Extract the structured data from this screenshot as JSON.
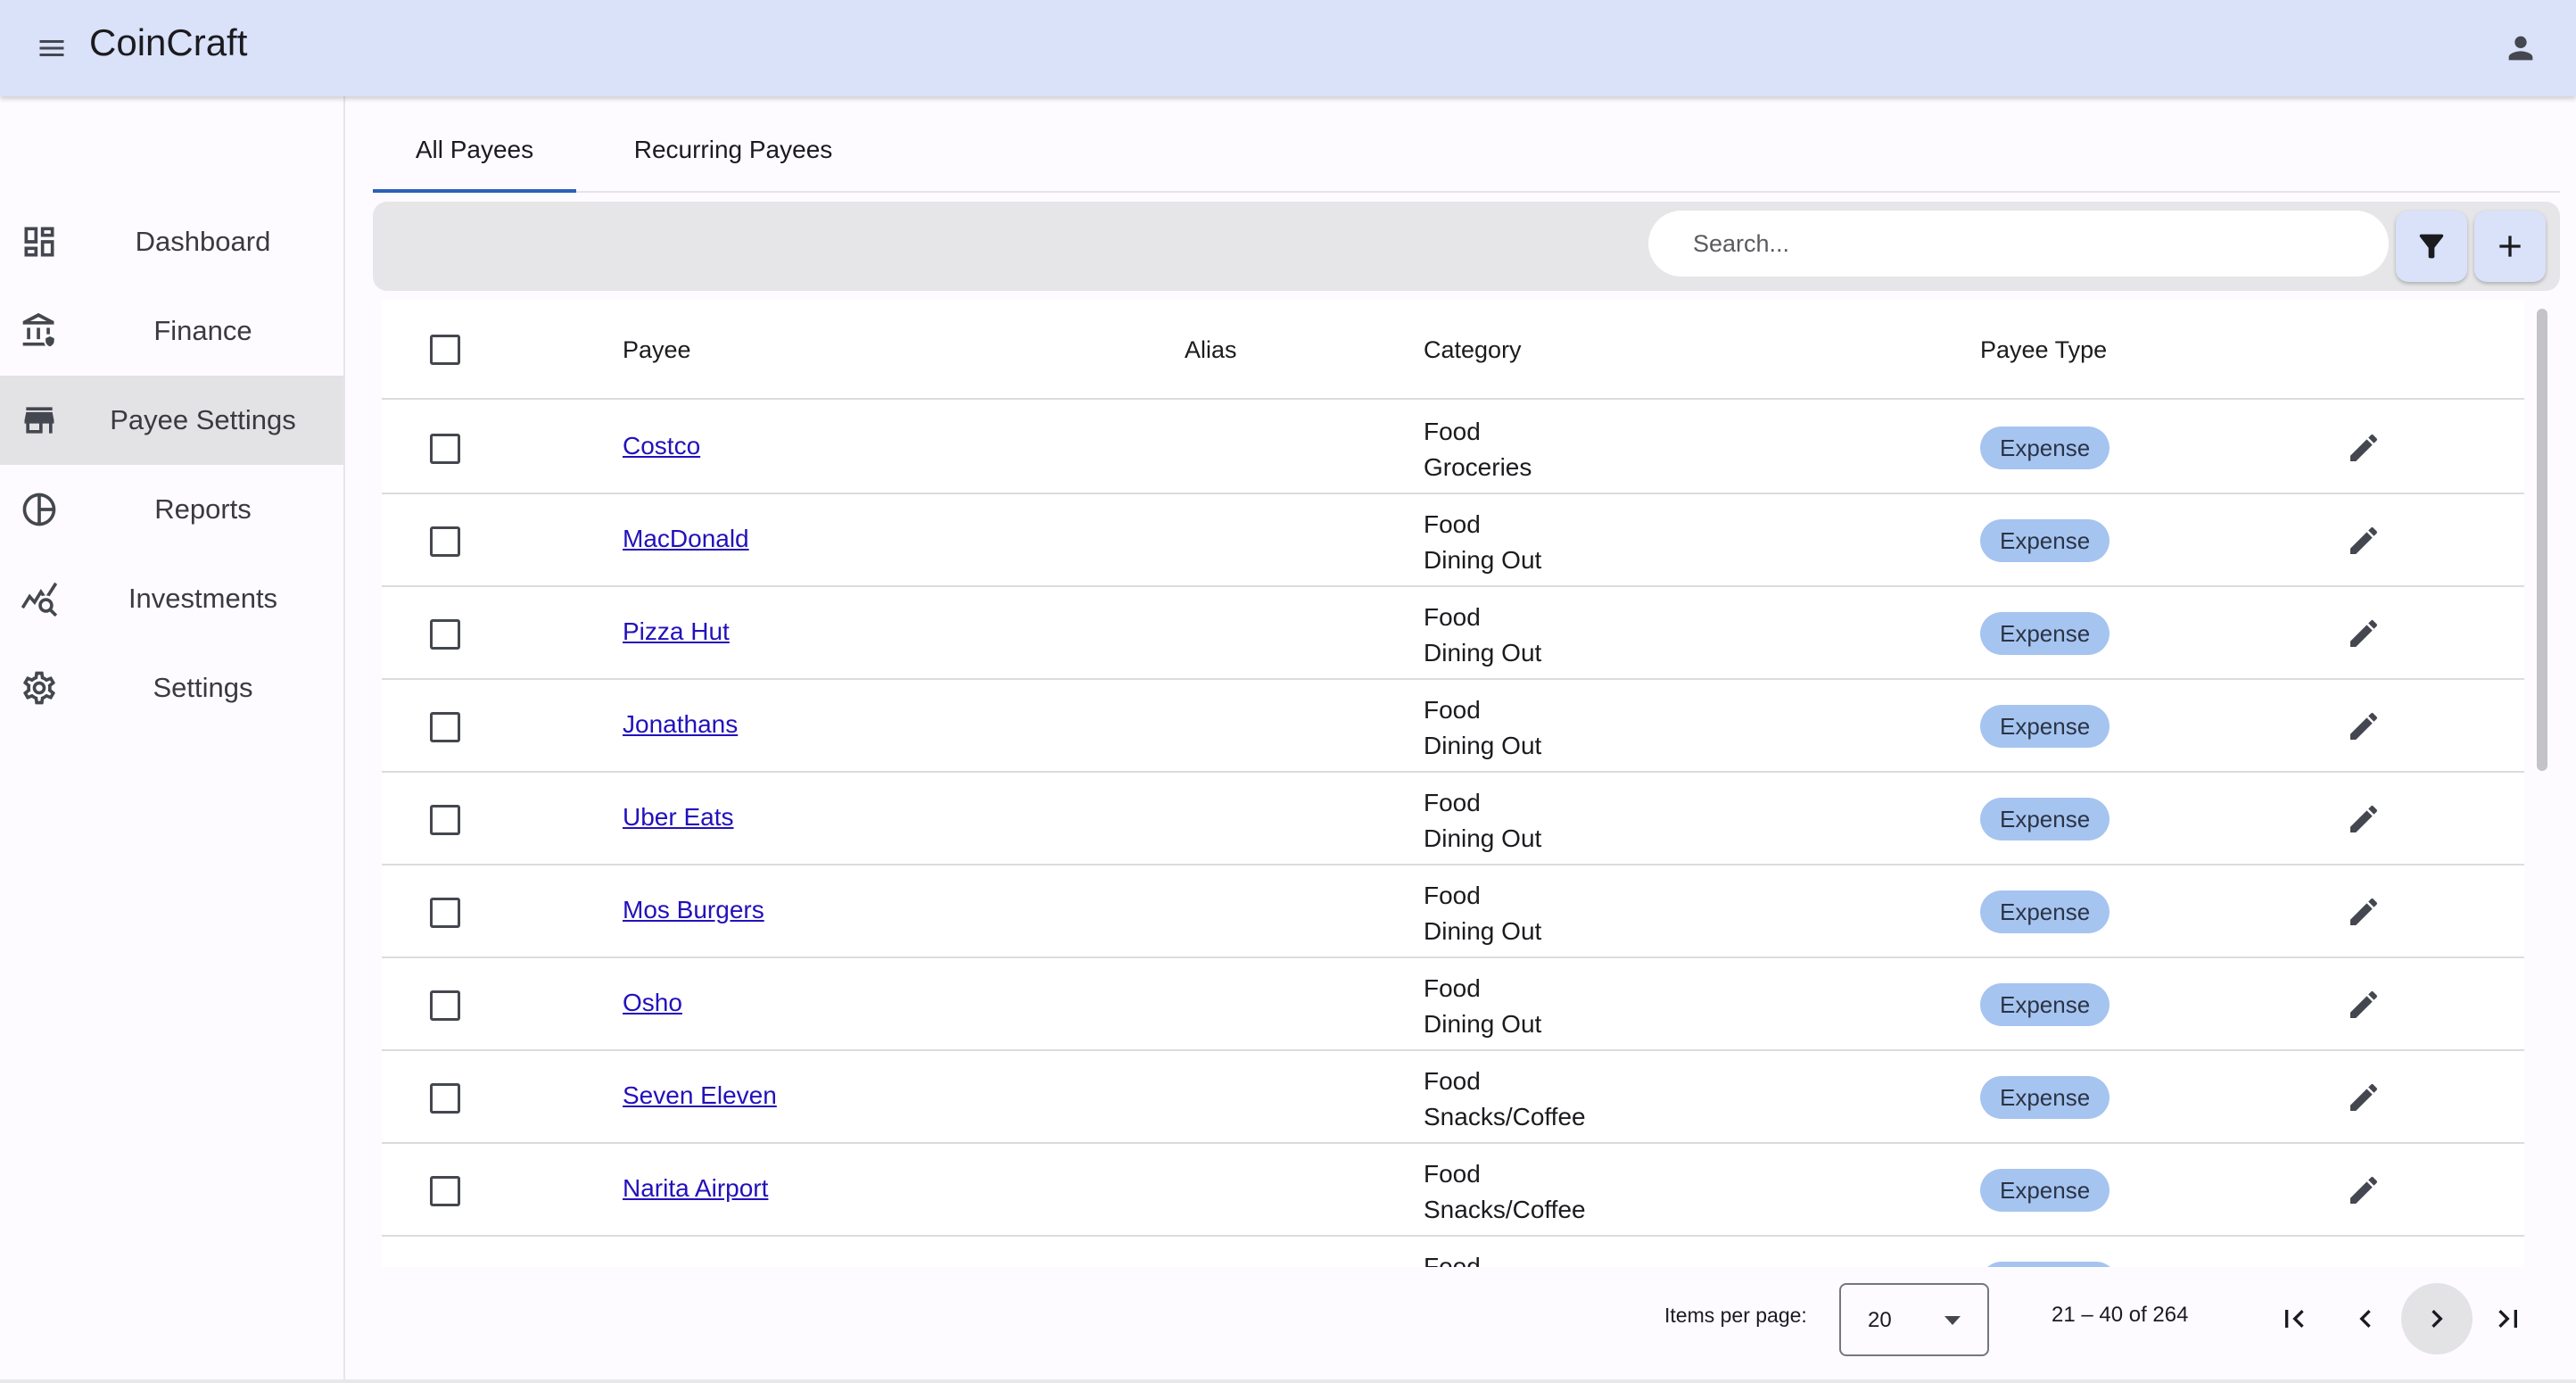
{
  "app": {
    "title": "CoinCraft"
  },
  "sidebar": {
    "items": [
      {
        "label": "Dashboard",
        "icon": "dashboard-icon"
      },
      {
        "label": "Finance",
        "icon": "bank-icon"
      },
      {
        "label": "Payee Settings",
        "icon": "store-icon",
        "active": true
      },
      {
        "label": "Reports",
        "icon": "pie-chart-icon"
      },
      {
        "label": "Investments",
        "icon": "query-stats-icon"
      },
      {
        "label": "Settings",
        "icon": "gear-icon"
      }
    ]
  },
  "tabs": [
    {
      "label": "All Payees",
      "active": true
    },
    {
      "label": "Recurring Payees"
    }
  ],
  "toolbar": {
    "search_placeholder": "Search..."
  },
  "table": {
    "columns": {
      "payee": "Payee",
      "alias": "Alias",
      "category": "Category",
      "payee_type": "Payee Type"
    },
    "rows": [
      {
        "payee": "Costco",
        "alias": "",
        "category": "Food",
        "subcategory": "Groceries",
        "type": "Expense"
      },
      {
        "payee": "MacDonald",
        "alias": "",
        "category": "Food",
        "subcategory": "Dining Out",
        "type": "Expense"
      },
      {
        "payee": "Pizza Hut",
        "alias": "",
        "category": "Food",
        "subcategory": "Dining Out",
        "type": "Expense"
      },
      {
        "payee": "Jonathans",
        "alias": "",
        "category": "Food",
        "subcategory": "Dining Out",
        "type": "Expense"
      },
      {
        "payee": "Uber Eats",
        "alias": "",
        "category": "Food",
        "subcategory": "Dining Out",
        "type": "Expense"
      },
      {
        "payee": "Mos Burgers",
        "alias": "",
        "category": "Food",
        "subcategory": "Dining Out",
        "type": "Expense"
      },
      {
        "payee": "Osho",
        "alias": "",
        "category": "Food",
        "subcategory": "Dining Out",
        "type": "Expense"
      },
      {
        "payee": "Seven Eleven",
        "alias": "",
        "category": "Food",
        "subcategory": "Snacks/Coffee",
        "type": "Expense"
      },
      {
        "payee": "Narita Airport",
        "alias": "",
        "category": "Food",
        "subcategory": "Snacks/Coffee",
        "type": "Expense"
      },
      {
        "payee": "",
        "alias": "",
        "category": "Food",
        "subcategory": "",
        "type": ""
      }
    ]
  },
  "paginator": {
    "items_per_page_label": "Items per page:",
    "items_per_page": "20",
    "range_label": "21 – 40 of 264"
  },
  "colors": {
    "topbar": "#dae2f9",
    "accent": "#2c5fb8",
    "badge": "#a6c4f0",
    "link": "#2211bb"
  }
}
